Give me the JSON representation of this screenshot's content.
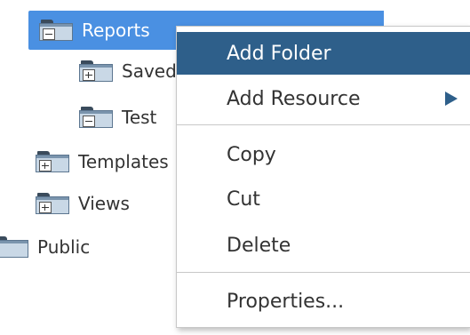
{
  "tree": {
    "reports": "Reports",
    "saved": "Saved Reports",
    "test": "Test",
    "templates": "Templates",
    "views": "Views",
    "public": "Public"
  },
  "context_menu": {
    "add_folder": "Add Folder",
    "add_resource": "Add Resource",
    "copy": "Copy",
    "cut": "Cut",
    "delete": "Delete",
    "properties": "Properties..."
  },
  "colors": {
    "selection": "#4a90e2",
    "menu_active": "#2e5f8a"
  }
}
